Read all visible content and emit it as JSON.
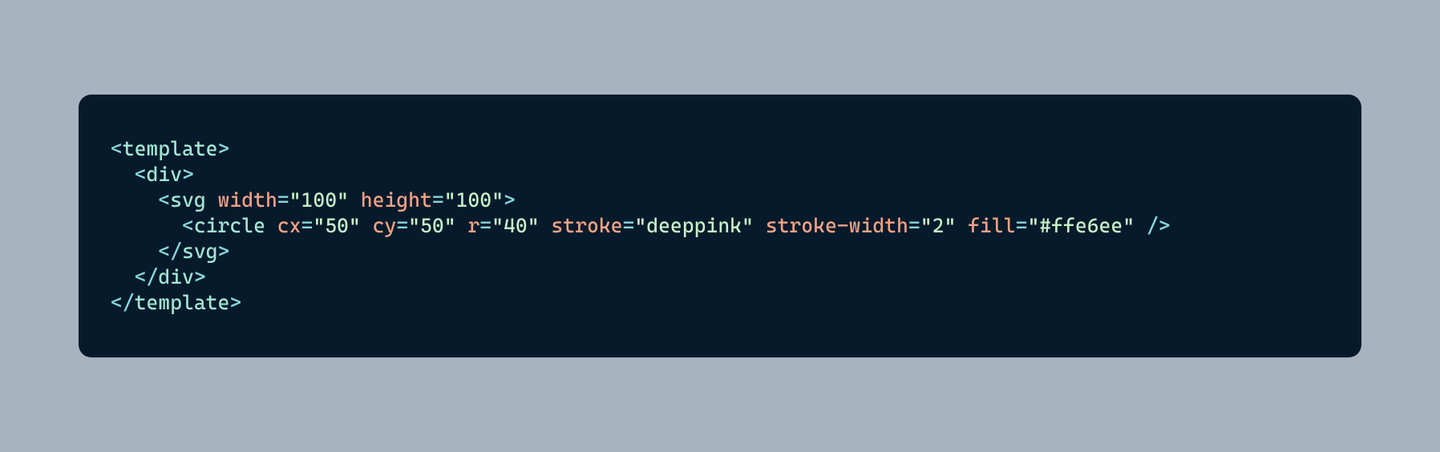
{
  "code": {
    "lines": [
      {
        "indent": 0,
        "open": true,
        "close": false,
        "selfclose": false,
        "tag": "template",
        "attrs": []
      },
      {
        "indent": 1,
        "open": true,
        "close": false,
        "selfclose": false,
        "tag": "div",
        "attrs": []
      },
      {
        "indent": 2,
        "open": true,
        "close": false,
        "selfclose": false,
        "tag": "svg",
        "attrs": [
          {
            "name": "width",
            "value": "100"
          },
          {
            "name": "height",
            "value": "100"
          }
        ]
      },
      {
        "indent": 3,
        "open": true,
        "close": false,
        "selfclose": true,
        "tag": "circle",
        "attrs": [
          {
            "name": "cx",
            "value": "50"
          },
          {
            "name": "cy",
            "value": "50"
          },
          {
            "name": "r",
            "value": "40"
          },
          {
            "name": "stroke",
            "value": "deeppink"
          },
          {
            "name": "stroke-width",
            "value": "2"
          },
          {
            "name": "fill",
            "value": "#ffe6ee"
          }
        ]
      },
      {
        "indent": 2,
        "open": false,
        "close": true,
        "selfclose": false,
        "tag": "svg",
        "attrs": []
      },
      {
        "indent": 1,
        "open": false,
        "close": true,
        "selfclose": false,
        "tag": "div",
        "attrs": []
      },
      {
        "indent": 0,
        "open": false,
        "close": true,
        "selfclose": false,
        "tag": "template",
        "attrs": []
      }
    ],
    "indentUnit": "  "
  }
}
